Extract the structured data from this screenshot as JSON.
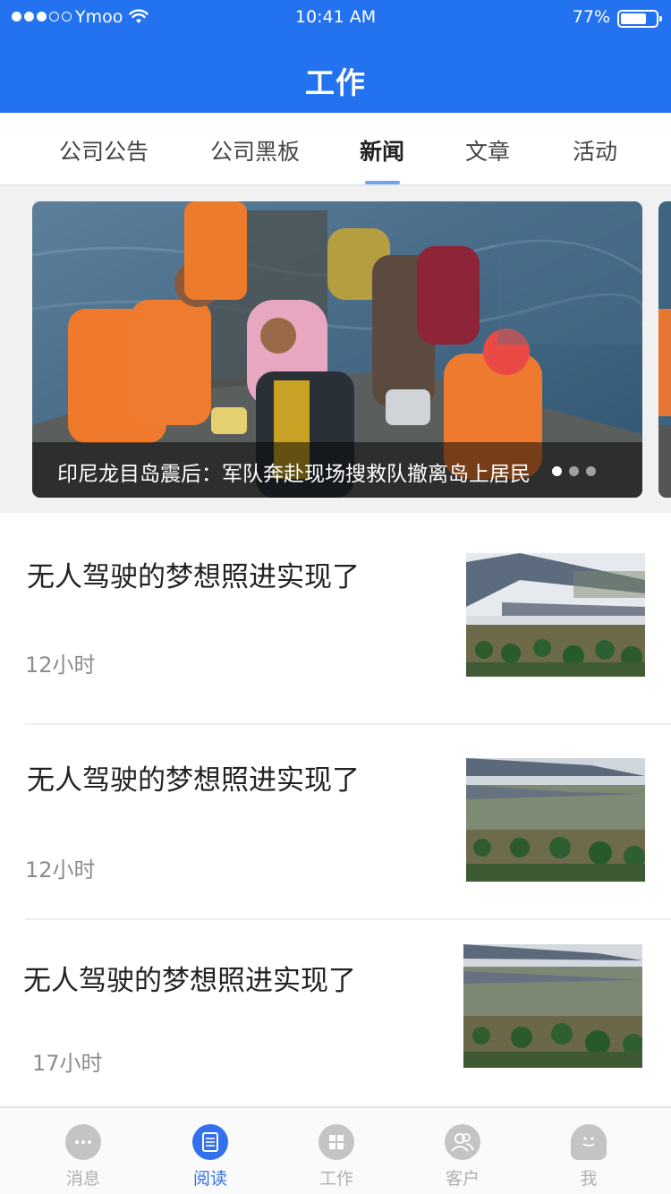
{
  "status_bar": {
    "carrier": "Ymoo",
    "time": "10:41 AM",
    "battery": "77%",
    "battery_level": 0.77
  },
  "header": {
    "title": "工作"
  },
  "tabs": [
    {
      "label": "公司公告",
      "active": false
    },
    {
      "label": "公司黑板",
      "active": false
    },
    {
      "label": "新闻",
      "active": true
    },
    {
      "label": "文章",
      "active": false
    },
    {
      "label": "活动",
      "active": false
    }
  ],
  "carousel": {
    "caption": "印尼龙目岛震后：军队奔赴现场搜救队撤离岛上居民",
    "page_count": 3,
    "current_page": 1
  },
  "news": [
    {
      "title": "无人驾驶的梦想照进实现了",
      "time": "12小时"
    },
    {
      "title": "无人驾驶的梦想照进实现了",
      "time": "12小时"
    },
    {
      "title": "无人驾驶的梦想照进实现了",
      "time": "17小时"
    }
  ],
  "bottom_nav": [
    {
      "label": "消息",
      "icon": "chat-bubble-icon",
      "active": false
    },
    {
      "label": "阅读",
      "icon": "document-icon",
      "active": true
    },
    {
      "label": "工作",
      "icon": "grid-apps-icon",
      "active": false
    },
    {
      "label": "客户",
      "icon": "users-icon",
      "active": false
    },
    {
      "label": "我",
      "icon": "person-icon",
      "active": false
    }
  ],
  "colors": {
    "primary": "#2372f0",
    "tab_indicator": "#6fa3ea",
    "nav_active": "#3270ee",
    "nav_inactive": "#b0b0b0"
  }
}
